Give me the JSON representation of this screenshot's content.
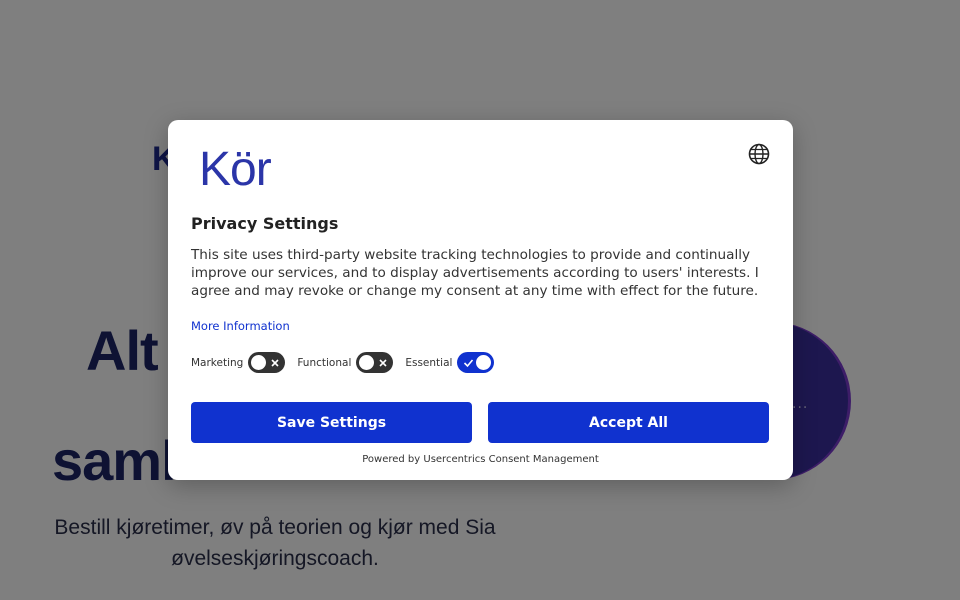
{
  "background": {
    "logo": "K",
    "headline_line1": "Alt",
    "headline_line2": "saml",
    "subtitle_line1": "Bestill kjøretimer, øv på teorien og kjør med Sia",
    "subtitle_line2": "øvelseskjøringscoach.",
    "circle_dots": "...",
    "colors": {
      "headline": "#1c2567",
      "circle": "#3a2f9e",
      "overlay": "rgba(0,0,0,0.5)"
    }
  },
  "dialog": {
    "logo": "Kör",
    "language_icon": "globe-icon",
    "title": "Privacy Settings",
    "description": "This site uses third-party website tracking technologies to provide and continually improve our services, and to display advertisements according to users' interests. I agree and may revoke or change my consent at any time with effect for the future.",
    "more_info": "More Information",
    "toggles": [
      {
        "label": "Marketing",
        "state": "off"
      },
      {
        "label": "Functional",
        "state": "off"
      },
      {
        "label": "Essential",
        "state": "on"
      }
    ],
    "save_button": "Save Settings",
    "accept_button": "Accept All",
    "powered_by": "Powered by Usercentrics Consent Management",
    "colors": {
      "accent": "#1032cf",
      "logo": "#2b35a8",
      "toggle_off": "#333333"
    }
  }
}
